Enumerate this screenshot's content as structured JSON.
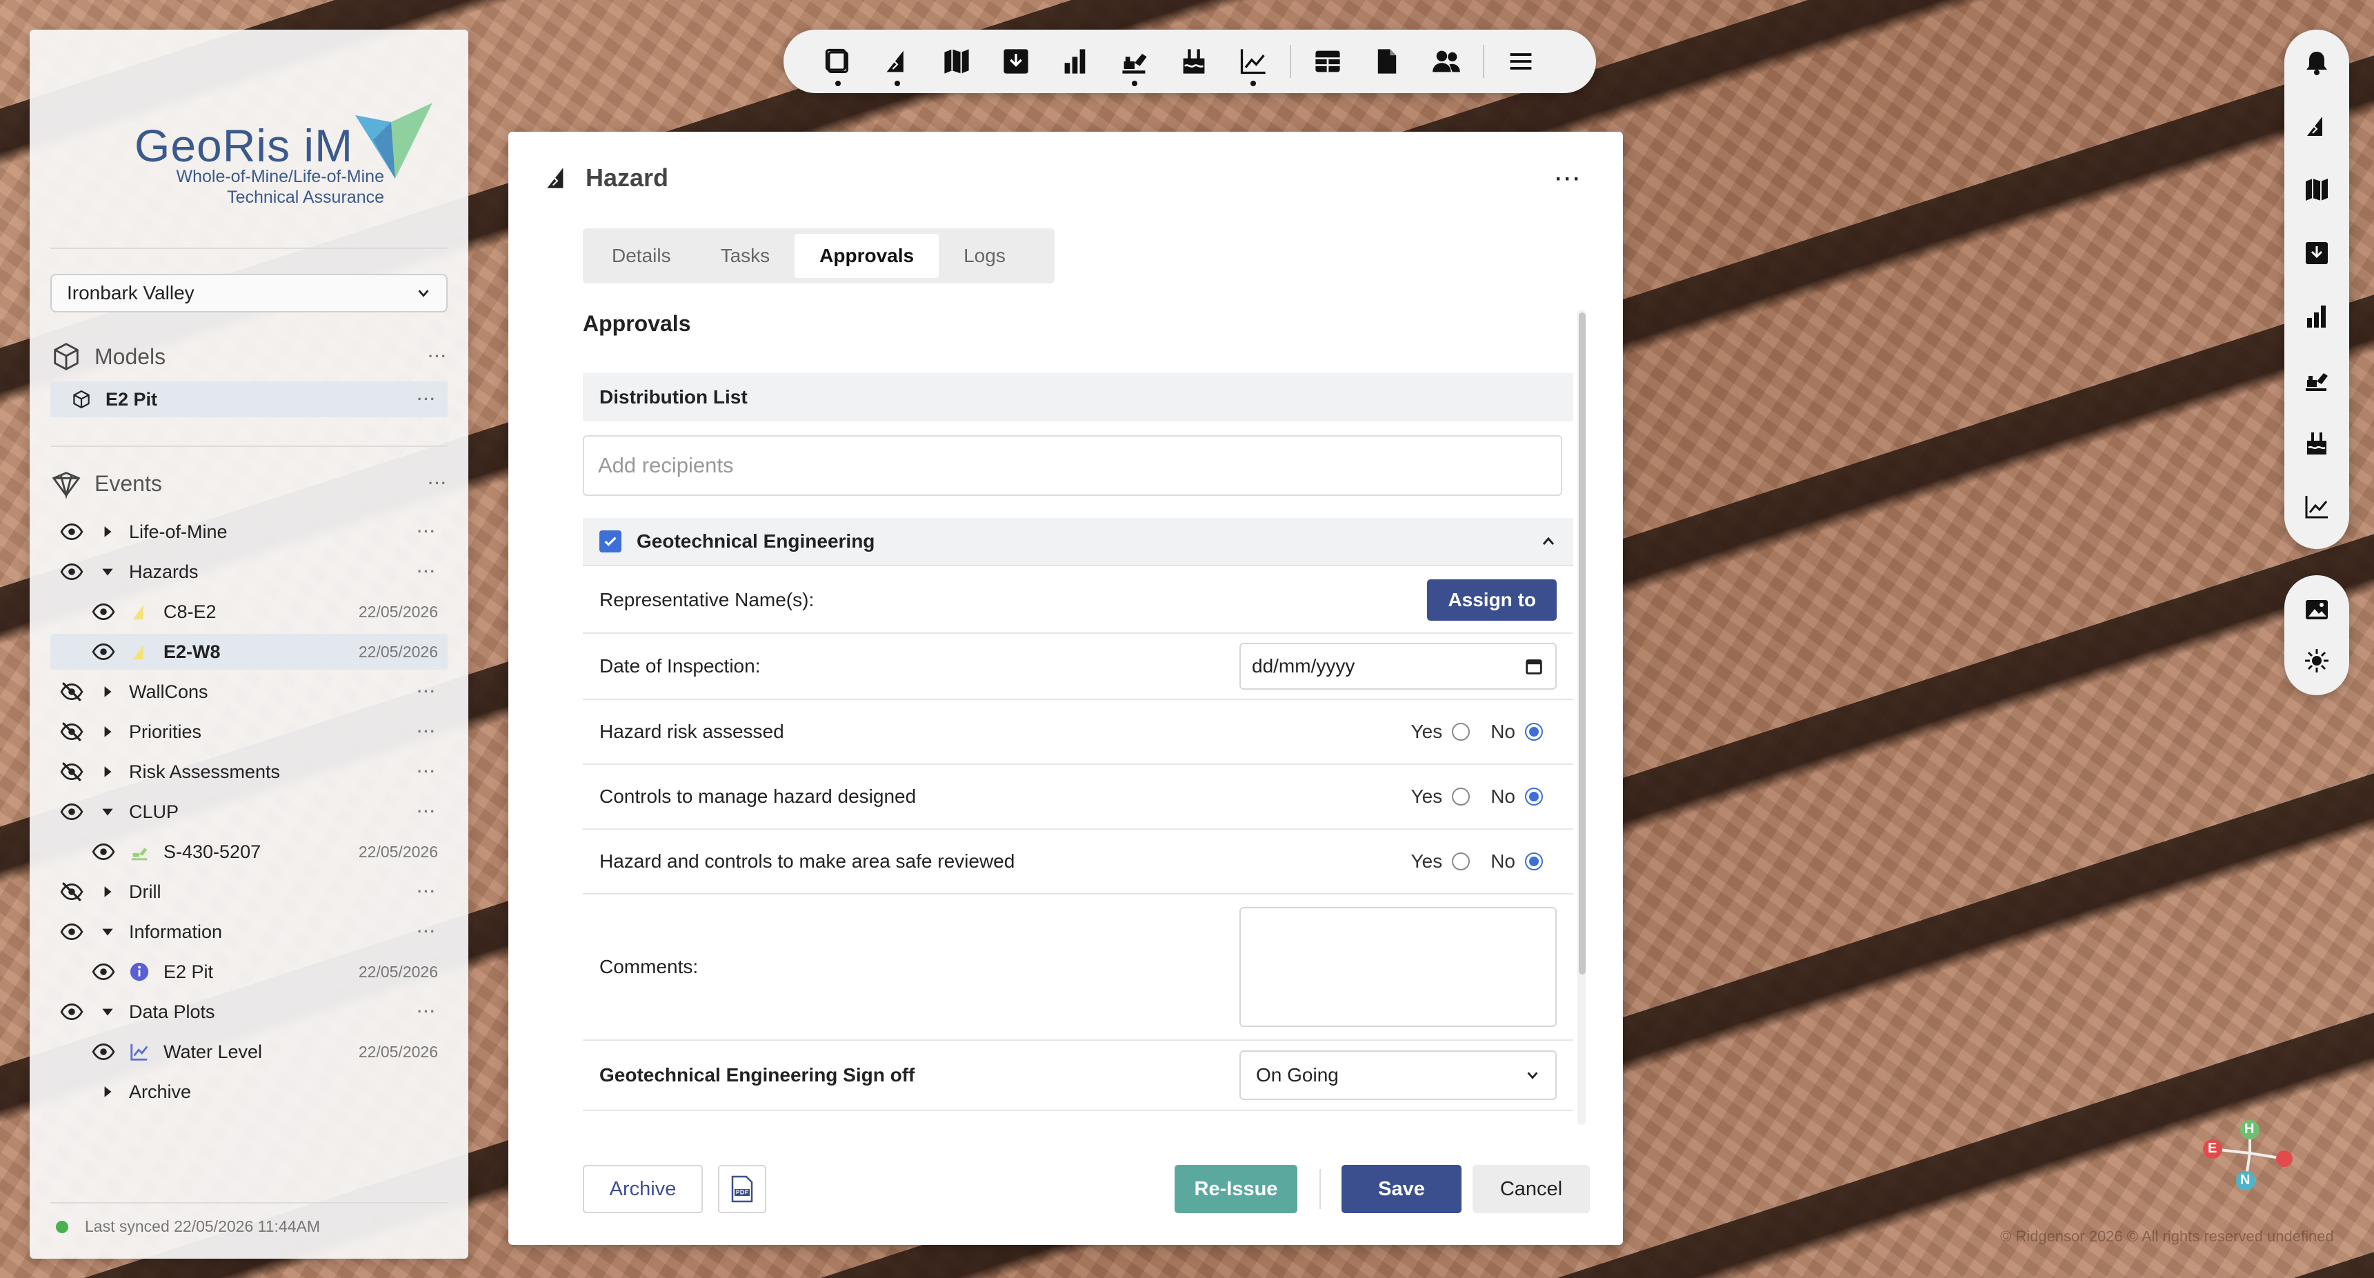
{
  "app": {
    "name": "GeoRis iM",
    "tagline_line1": "Whole-of-Mine/Life-of-Mine",
    "tagline_line2": "Technical Assurance",
    "site": "Ironbark Valley",
    "sync_text": "Last synced 22/05/2026 11:44AM",
    "copyright": "© Ridgensor 2026 © All rights reserved undefined"
  },
  "sidebar": {
    "models_label": "Models",
    "model_item": "E2 Pit",
    "events_label": "Events",
    "events": [
      {
        "label": "Life-of-Mine",
        "visible": true,
        "expanded": false
      },
      {
        "label": "Hazards",
        "visible": true,
        "expanded": true
      },
      {
        "label": "C8-E2",
        "date": "22/05/2026",
        "child": true
      },
      {
        "label": "E2-W8",
        "date": "22/05/2026",
        "child": true,
        "selected": true
      },
      {
        "label": "WallCons",
        "visible": false,
        "expanded": false
      },
      {
        "label": "Priorities",
        "visible": false,
        "expanded": false
      },
      {
        "label": "Risk Assessments",
        "visible": false,
        "expanded": false
      },
      {
        "label": "CLUP",
        "visible": true,
        "expanded": true
      },
      {
        "label": "S-430-5207",
        "date": "22/05/2026",
        "child": true
      },
      {
        "label": "Drill",
        "visible": false,
        "expanded": false
      },
      {
        "label": "Information",
        "visible": true,
        "expanded": true
      },
      {
        "label": "E2 Pit",
        "date": "22/05/2026",
        "child": true
      },
      {
        "label": "Data Plots",
        "visible": true,
        "expanded": true
      },
      {
        "label": "Water Level",
        "date": "22/05/2026",
        "child": true
      },
      {
        "label": "Archive",
        "expanded": false
      }
    ]
  },
  "panel": {
    "title": "Hazard",
    "tabs": [
      "Details",
      "Tasks",
      "Approvals",
      "Logs"
    ],
    "active_tab": "Approvals",
    "section_title": "Approvals",
    "distribution_list": "Distribution List",
    "recipients_placeholder": "Add recipients",
    "group_label": "Geotechnical Engineering",
    "group_checked": true,
    "representative_label": "Representative Name(s):",
    "assign_label": "Assign to",
    "date_label": "Date of Inspection:",
    "date_placeholder": "dd/mm/yyyy",
    "questions": [
      {
        "label": "Hazard risk assessed",
        "value": "No"
      },
      {
        "label": "Controls to manage hazard designed",
        "value": "No"
      },
      {
        "label": "Hazard and controls to make area safe reviewed",
        "value": "No"
      }
    ],
    "yes_label": "Yes",
    "no_label": "No",
    "comments_label": "Comments:",
    "signoff_label": "Geotechnical Engineering Sign off",
    "signoff_value": "On Going"
  },
  "footer": {
    "archive": "Archive",
    "reissue": "Re-Issue",
    "save": "Save",
    "cancel": "Cancel"
  },
  "compass": {
    "h": "H",
    "e": "E",
    "n": "N"
  },
  "colors": {
    "accent": "#3b4f8e",
    "reissue": "#5ba89f",
    "check": "#3d6fd6"
  }
}
